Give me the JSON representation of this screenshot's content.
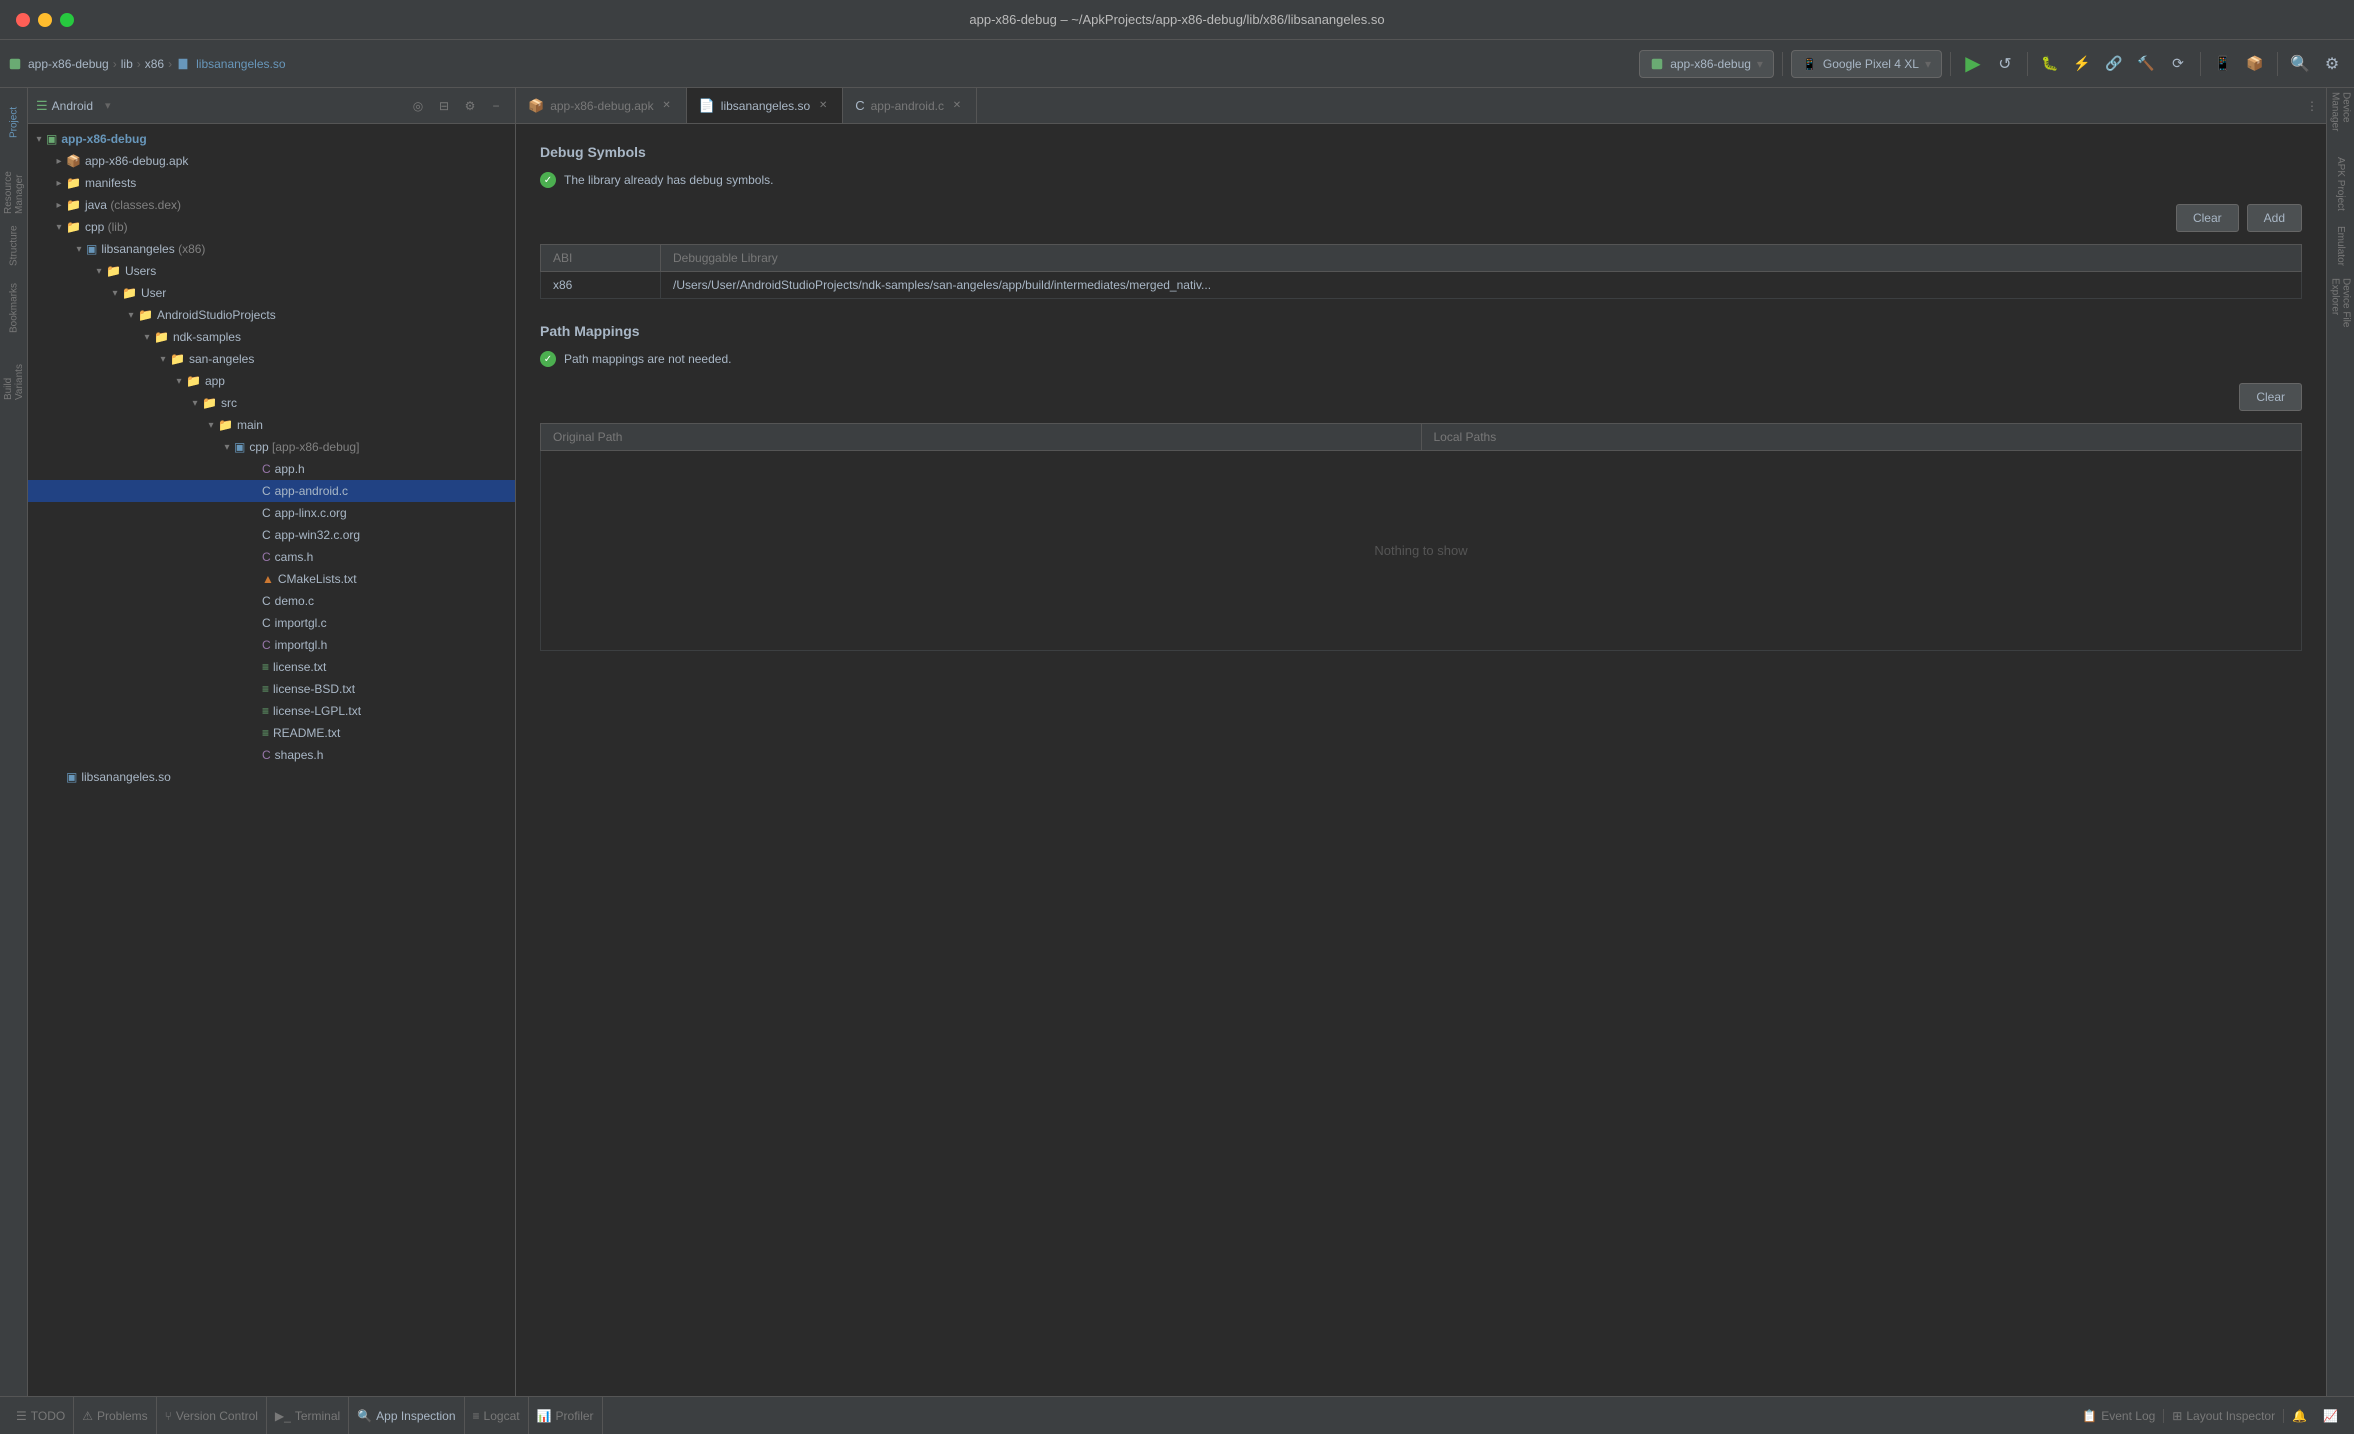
{
  "window": {
    "title": "app-x86-debug – ~/ApkProjects/app-x86-debug/lib/x86/libsanangeles.so",
    "traffic_lights": [
      "close",
      "minimize",
      "maximize"
    ]
  },
  "toolbar": {
    "breadcrumb": [
      "app-x86-debug",
      "lib",
      "x86",
      "libsanangeles.so"
    ],
    "device": "app-x86-debug",
    "emulator": "Google Pixel 4 XL"
  },
  "filetree": {
    "panel_title": "Android",
    "items": [
      {
        "id": "app-x86-debug",
        "label": "app-x86-debug",
        "type": "module",
        "depth": 0,
        "expanded": true
      },
      {
        "id": "apk",
        "label": "app-x86-debug.apk",
        "type": "apk",
        "depth": 1,
        "expanded": false
      },
      {
        "id": "manifests",
        "label": "manifests",
        "type": "folder",
        "depth": 1,
        "expanded": false
      },
      {
        "id": "java",
        "label": "java",
        "type": "folder",
        "depth": 1,
        "expanded": false,
        "suffix": "(classes.dex)"
      },
      {
        "id": "cpp",
        "label": "cpp",
        "type": "folder",
        "depth": 1,
        "expanded": true,
        "suffix": "(lib)"
      },
      {
        "id": "libsanangeles",
        "label": "libsanangeles",
        "type": "lib",
        "depth": 2,
        "expanded": true,
        "suffix": "(x86)"
      },
      {
        "id": "Users",
        "label": "Users",
        "type": "folder",
        "depth": 3,
        "expanded": true
      },
      {
        "id": "User",
        "label": "User",
        "type": "folder",
        "depth": 4,
        "expanded": true
      },
      {
        "id": "AndroidStudioProjects",
        "label": "AndroidStudioProjects",
        "type": "folder",
        "depth": 5,
        "expanded": true
      },
      {
        "id": "ndk-samples",
        "label": "ndk-samples",
        "type": "folder",
        "depth": 6,
        "expanded": true
      },
      {
        "id": "san-angeles",
        "label": "san-angeles",
        "type": "folder",
        "depth": 7,
        "expanded": true
      },
      {
        "id": "app",
        "label": "app",
        "type": "folder",
        "depth": 8,
        "expanded": true
      },
      {
        "id": "src",
        "label": "src",
        "type": "folder",
        "depth": 9,
        "expanded": true
      },
      {
        "id": "main",
        "label": "main",
        "type": "folder",
        "depth": 10,
        "expanded": true
      },
      {
        "id": "cpp-app-x86-debug",
        "label": "cpp [app-x86-debug]",
        "type": "cppmodule",
        "depth": 11,
        "expanded": true
      },
      {
        "id": "app.h",
        "label": "app.h",
        "type": "h",
        "depth": 12
      },
      {
        "id": "app-android.c",
        "label": "app-android.c",
        "type": "c",
        "depth": 12,
        "selected": true
      },
      {
        "id": "app-linx.c.org",
        "label": "app-linx.c.org",
        "type": "c",
        "depth": 12
      },
      {
        "id": "app-win32.c.org",
        "label": "app-win32.c.org",
        "type": "c",
        "depth": 12
      },
      {
        "id": "cams.h",
        "label": "cams.h",
        "type": "h",
        "depth": 12
      },
      {
        "id": "CMakeLists.txt",
        "label": "CMakeLists.txt",
        "type": "cmake",
        "depth": 12
      },
      {
        "id": "demo.c",
        "label": "demo.c",
        "type": "c",
        "depth": 12
      },
      {
        "id": "importgl.c",
        "label": "importgl.c",
        "type": "c",
        "depth": 12
      },
      {
        "id": "importgl.h",
        "label": "importgl.h",
        "type": "h",
        "depth": 12
      },
      {
        "id": "license.txt",
        "label": "license.txt",
        "type": "txt",
        "depth": 12
      },
      {
        "id": "license-BSD.txt",
        "label": "license-BSD.txt",
        "type": "txt",
        "depth": 12
      },
      {
        "id": "license-LGPL.txt",
        "label": "license-LGPL.txt",
        "type": "txt",
        "depth": 12
      },
      {
        "id": "README.txt",
        "label": "README.txt",
        "type": "txt",
        "depth": 12
      },
      {
        "id": "shapes.h",
        "label": "shapes.h",
        "type": "h",
        "depth": 12
      },
      {
        "id": "libsanangeles2",
        "label": "libsanangeles.so",
        "type": "lib",
        "depth": 1
      }
    ]
  },
  "tabs": [
    {
      "id": "apk-tab",
      "label": "app-x86-debug.apk",
      "active": false,
      "type": "apk"
    },
    {
      "id": "lib-tab",
      "label": "libsanangeles.so",
      "active": true,
      "type": "lib"
    },
    {
      "id": "android-tab",
      "label": "app-android.c",
      "active": false,
      "type": "c"
    }
  ],
  "debug_symbols": {
    "title": "Debug Symbols",
    "status_message": "The library already has debug symbols.",
    "clear_button": "Clear",
    "add_button": "Add",
    "table": {
      "columns": [
        "ABI",
        "Debuggable Library"
      ],
      "rows": [
        {
          "abi": "x86",
          "path": "/Users/User/AndroidStudioProjects/ndk-samples/san-angeles/app/build/intermediates/merged_nativ..."
        }
      ]
    }
  },
  "path_mappings": {
    "title": "Path Mappings",
    "status_message": "Path mappings are not needed.",
    "clear_button": "Clear",
    "table": {
      "columns": [
        "Original Path",
        "Local Paths"
      ],
      "empty_message": "Nothing to show"
    }
  },
  "right_sidebar": {
    "items": [
      "Device Manager",
      "APK Project",
      "Emulator",
      "Device File Explorer"
    ]
  },
  "left_sidebar": {
    "items": [
      "Project",
      "Resource Manager",
      "Structure",
      "Bookmarks",
      "Build Variants"
    ]
  },
  "status_bar": {
    "items": [
      {
        "icon": "list-icon",
        "label": "TODO"
      },
      {
        "icon": "warning-icon",
        "label": "Problems"
      },
      {
        "icon": "vcs-icon",
        "label": "Version Control"
      },
      {
        "icon": "terminal-icon",
        "label": "Terminal"
      },
      {
        "icon": "inspection-icon",
        "label": "App Inspection"
      },
      {
        "icon": "logcat-icon",
        "label": "Logcat"
      },
      {
        "icon": "profiler-icon",
        "label": "Profiler"
      }
    ],
    "right_items": [
      {
        "icon": "event-log-icon",
        "label": "Event Log"
      },
      {
        "icon": "layout-icon",
        "label": "Layout Inspector"
      }
    ]
  }
}
